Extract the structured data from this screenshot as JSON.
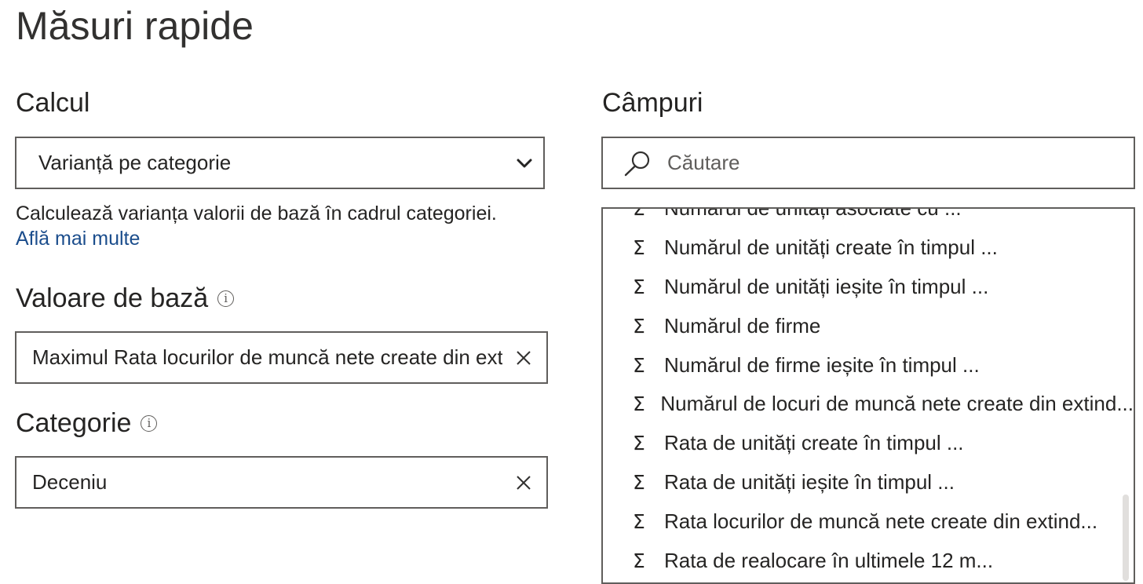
{
  "page": {
    "title": "Măsuri rapide"
  },
  "calcul": {
    "label": "Calcul",
    "selected": "Varianță pe categorie",
    "description": "Calculează varianța valorii de bază în cadrul categoriei.",
    "learn_more": "Află mai multe"
  },
  "base_value": {
    "label": "Valoare de bază",
    "value": "Maximul Rata locurilor de muncă nete create din extinderea"
  },
  "category": {
    "label": "Categorie",
    "value": "Deceniu"
  },
  "fields": {
    "label": "Câmpuri",
    "search_placeholder": "Căutare",
    "items": [
      {
        "label": "Numărul de unități asociate cu ..."
      },
      {
        "label": "Numărul de unități create în timpul ..."
      },
      {
        "label": "Numărul de unități ieșite în timpul ..."
      },
      {
        "label": "Numărul de firme"
      },
      {
        "label": "Numărul de firme ieșite în timpul ..."
      },
      {
        "label": "Numărul de locuri de muncă nete create din extind..."
      },
      {
        "label": "Rata de unități create în timpul ..."
      },
      {
        "label": "Rata de unități ieșite în timpul ..."
      },
      {
        "label": "Rata locurilor de muncă nete create din extind..."
      },
      {
        "label": "Rata de realocare în ultimele 12 m..."
      }
    ]
  },
  "icons": {
    "field_type": "sigma-icon",
    "sigma_glyph": "Σ",
    "info_glyph": "i"
  },
  "colors": {
    "text": "#252423",
    "link": "#1b4d8c",
    "border": "#605e5c",
    "placeholder": "#605e5c"
  }
}
